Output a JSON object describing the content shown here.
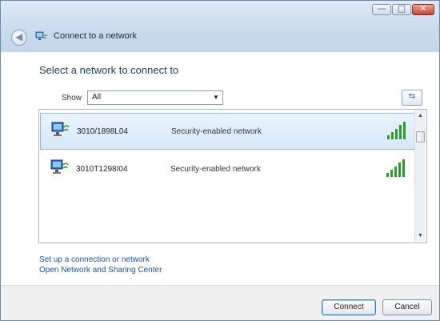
{
  "window": {
    "title": "Connect to a network",
    "caption_buttons": {
      "minimize": "—",
      "maximize": "□",
      "close": "✕"
    },
    "back_glyph": "◀"
  },
  "heading": "Select a network to connect to",
  "filter": {
    "label": "Show",
    "selected": "All",
    "dropdown_glyph": "▼"
  },
  "refresh_glyph": "⇆",
  "networks": [
    {
      "name": "3010/1898L04",
      "security": "Security-enabled network",
      "selected": true
    },
    {
      "name": "3010T1298I04",
      "security": "Security-enabled network",
      "selected": false
    }
  ],
  "scrollbar": {
    "up": "▲",
    "down": "▼"
  },
  "links": {
    "setup": "Set up a connection or network",
    "network_center": "Open Network and Sharing Center"
  },
  "buttons": {
    "connect": "Connect",
    "cancel": "Cancel"
  },
  "colors": {
    "accent": "#1f3a6b",
    "link": "#1a4fb5",
    "signal": "#2c9a2c",
    "selection": "#d6e7f8"
  }
}
